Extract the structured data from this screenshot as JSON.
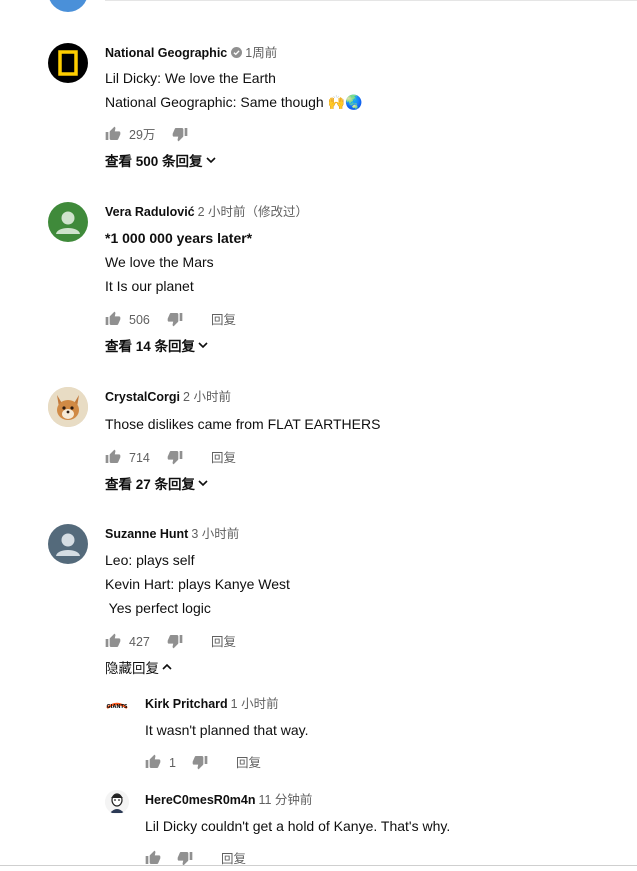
{
  "comments": [
    {
      "author": "National Geographic",
      "time": "1周前",
      "lines": [
        "Lil Dicky: We love the Earth",
        "National Geographic: Same though 🙌🌏"
      ],
      "likes": "29万",
      "view_replies": "查看 500 条回复"
    },
    {
      "author": "Vera Radulović",
      "time": "2 小时前（修改过）",
      "lines": [
        "*1 000 000 years later*",
        "We love the Mars",
        "It Is our planet"
      ],
      "likes": "506",
      "reply": "回复",
      "view_replies": "查看 14 条回复"
    },
    {
      "author": "CrystalCorgi",
      "time": "2 小时前",
      "lines": [
        "Those dislikes came from FLAT EARTHERS"
      ],
      "likes": "714",
      "reply": "回复",
      "view_replies": "查看 27 条回复"
    },
    {
      "author": "Suzanne Hunt",
      "time": "3 小时前",
      "lines": [
        "Leo: plays self",
        "Kevin Hart: plays Kanye West",
        " Yes perfect logic"
      ],
      "likes": "427",
      "reply": "回复",
      "hide_replies": "隐藏回复"
    }
  ],
  "replies": [
    {
      "author": "Kirk Pritchard",
      "time": "1 小时前",
      "text": "It wasn't planned that way.",
      "likes": "1",
      "reply": "回复",
      "avatar_text": "GIANTS"
    },
    {
      "author": "HereC0mesR0m4n",
      "time": "11 分钟前",
      "text": "Lil Dicky couldn't get a hold of Kanye. That's why.",
      "reply": "回复"
    }
  ]
}
